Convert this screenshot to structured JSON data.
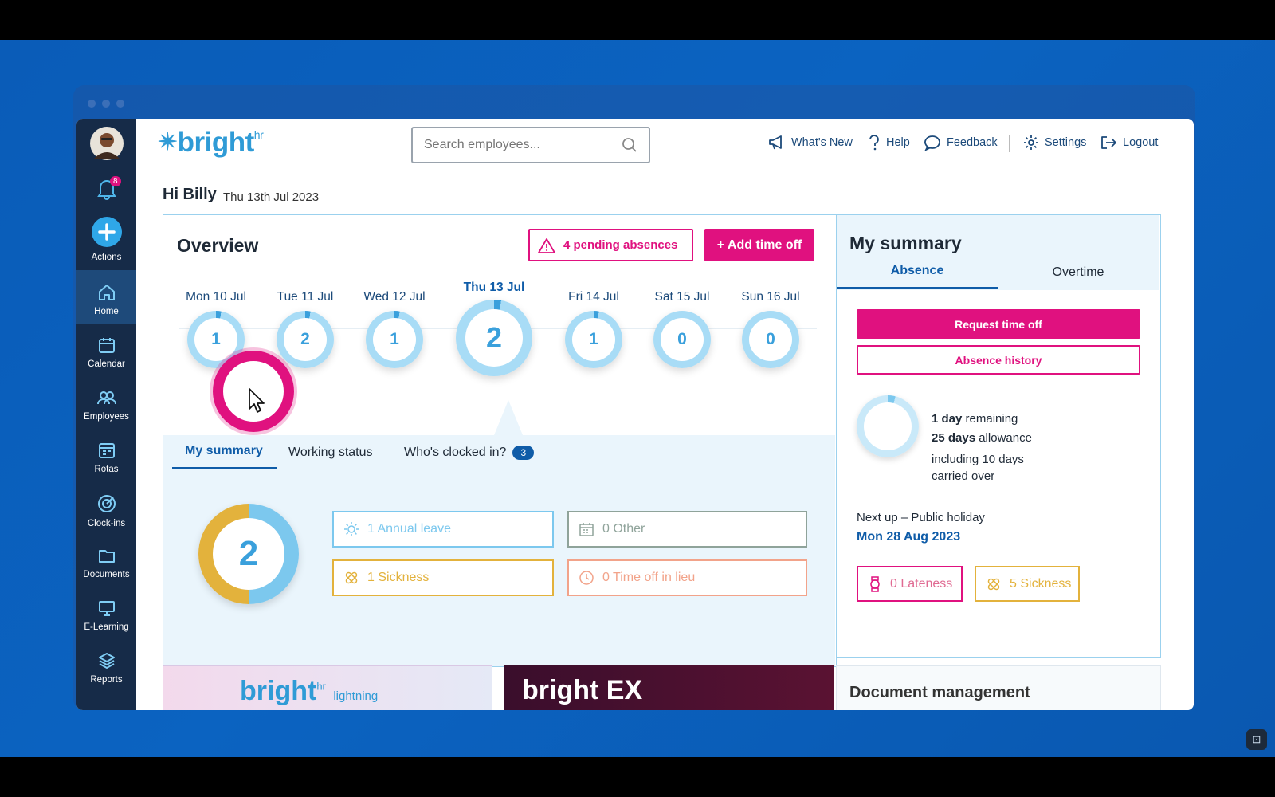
{
  "sidebar": {
    "notification_count": "8",
    "items": [
      {
        "label": "Actions"
      },
      {
        "label": "Home"
      },
      {
        "label": "Calendar"
      },
      {
        "label": "Employees"
      },
      {
        "label": "Rotas"
      },
      {
        "label": "Clock-ins"
      },
      {
        "label": "Documents"
      },
      {
        "label": "E-Learning"
      },
      {
        "label": "Reports"
      }
    ]
  },
  "header": {
    "logo_text": "bright",
    "logo_sup": "hr",
    "search_placeholder": "Search employees...",
    "nav": [
      {
        "label": "What's New",
        "icon": "megaphone-icon"
      },
      {
        "label": "Help",
        "icon": "question-icon"
      },
      {
        "label": "Feedback",
        "icon": "chat-bubble-icon"
      },
      {
        "label": "Settings",
        "icon": "gear-icon"
      },
      {
        "label": "Logout",
        "icon": "logout-icon"
      }
    ]
  },
  "greeting": {
    "text": "Hi Billy",
    "date": "Thu 13th Jul 2023"
  },
  "overview": {
    "title": "Overview",
    "pending_label": "4 pending absences",
    "add_label": "+ Add time off",
    "days": [
      {
        "label": "Mon 10 Jul",
        "count": "1",
        "selected": false
      },
      {
        "label": "Tue 11 Jul",
        "count": "2",
        "selected": false
      },
      {
        "label": "Wed 12 Jul",
        "count": "1",
        "selected": false
      },
      {
        "label": "Thu 13 Jul",
        "count": "2",
        "selected": true
      },
      {
        "label": "Fri 14 Jul",
        "count": "1",
        "selected": false
      },
      {
        "label": "Sat 15 Jul",
        "count": "0",
        "selected": false
      },
      {
        "label": "Sun 16 Jul",
        "count": "0",
        "selected": false
      }
    ],
    "tabs": [
      {
        "label": "My summary",
        "active": true
      },
      {
        "label": "Working status",
        "active": false
      },
      {
        "label": "Who's clocked in?",
        "badge": "3",
        "active": false
      }
    ],
    "total": "2",
    "stats": [
      {
        "label": "1 Annual leave",
        "color": "#7cc8ee",
        "icon": "sun-icon"
      },
      {
        "label": "0 Other",
        "color": "#8fa39a",
        "icon": "calendar-icon"
      },
      {
        "label": "1 Sickness",
        "color": "#e3b23c",
        "icon": "bandage-icon"
      },
      {
        "label": "0 Time off in lieu",
        "color": "#f2a38a",
        "icon": "clock-icon"
      }
    ]
  },
  "my_summary": {
    "title": "My summary",
    "tabs": [
      {
        "label": "Absence",
        "active": true
      },
      {
        "label": "Overtime",
        "active": false
      }
    ],
    "request_label": "Request time off",
    "history_label": "Absence history",
    "remaining_bold": "1 day",
    "remaining_rest": " remaining",
    "allowance_bold": "25 days",
    "allowance_rest": " allowance",
    "carried": "including 10 days carried over",
    "next_up_label": "Next up – Public holiday",
    "next_up_date": "Mon 28 Aug 2023",
    "lateness_label": "0 Lateness",
    "sickness_label": "5 Sickness"
  },
  "promos": {
    "lightning_logo": "bright",
    "lightning_sup": "hr",
    "lightning_word": "lightning",
    "ex_logo": "bright",
    "ex_word": "EX",
    "doc_title": "Document management"
  },
  "colors": {
    "brand_pink": "#e0117f",
    "brand_blue": "#2f9bd6",
    "sidebar": "#162b48",
    "annual": "#7cc8ee",
    "sickness": "#e3b23c"
  }
}
